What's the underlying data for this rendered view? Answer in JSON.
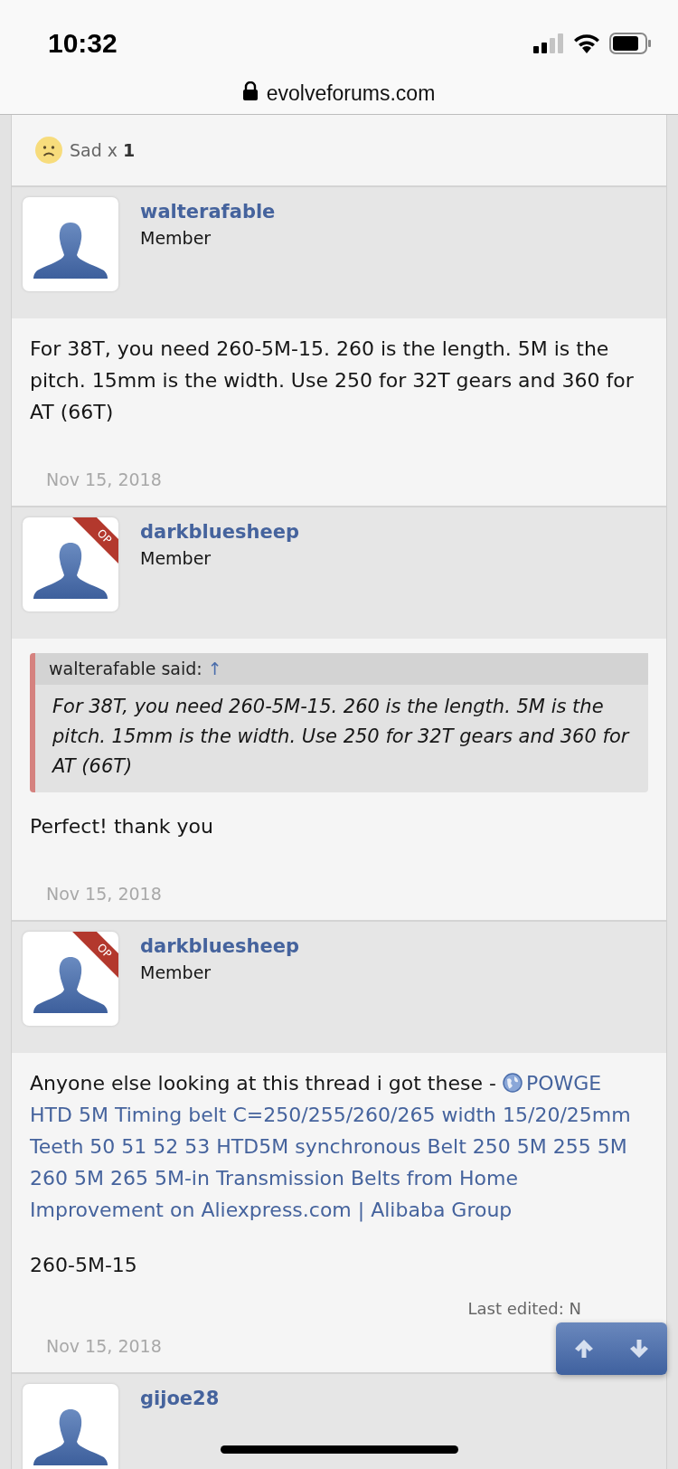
{
  "status_bar": {
    "time": "10:32"
  },
  "address_bar": {
    "url": "evolveforums.com",
    "secure": true
  },
  "reactions": {
    "text": "Sad x **1**"
  },
  "posts": [
    {
      "author": "walterafable",
      "role": "Member",
      "op": false,
      "blocks": [
        {
          "kind": "text",
          "text": "For 38T, you need 260-5M-15. 260 is the length. 5M is the pitch. 15mm is the width. Use 250 for 32T gears and 360 for AT (66T)"
        }
      ],
      "date": "Nov 15, 2018"
    },
    {
      "author": "darkbluesheep",
      "role": "Member",
      "op": true,
      "op_label": "OP",
      "blocks": [
        {
          "kind": "quote",
          "attribution": "walterafable said:",
          "jump": "↑",
          "text": "For 38T, you need 260-5M-15. 260 is the length. 5M is the pitch. 15mm is the width. Use 250 for 32T gears and 360 for AT (66T)"
        },
        {
          "kind": "text",
          "text": "Perfect! thank you"
        }
      ],
      "date": "Nov 15, 2018"
    },
    {
      "author": "darkbluesheep",
      "role": "Member",
      "op": true,
      "op_label": "OP",
      "blocks": [
        {
          "kind": "link",
          "text": "Anyone else looking at this thread i got these - ",
          "link": "POWGE HTD 5M Timing belt C=250/255/260/265 width 15/20/25mm Teeth 50 51 52 53 HTD5M synchronous Belt 250 5M 255 5M 260 5M 265 5M-in Transmission Belts from Home Improvement on Aliexpress.com | Alibaba Group"
        },
        {
          "kind": "text",
          "text": "260-5M-15"
        }
      ],
      "edited": "Last edited: N",
      "date": "Nov 15, 2018"
    },
    {
      "author": "gijoe28",
      "op": false
    }
  ]
}
